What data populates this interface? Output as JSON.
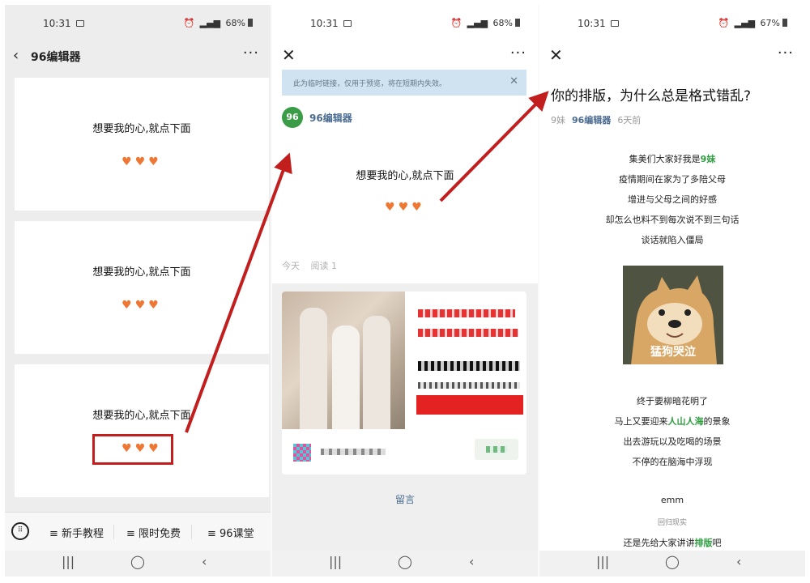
{
  "panel1": {
    "status": {
      "time": "10:31",
      "battery": "68%"
    },
    "title": "96编辑器",
    "cards": [
      {
        "text": "想要我的心,就点下面",
        "hearts": "♥♥♥"
      },
      {
        "text": "想要我的心,就点下面",
        "hearts": "♥♥♥"
      },
      {
        "text": "想要我的心,就点下面",
        "hearts": "♥♥♥"
      }
    ],
    "menu": [
      "≡ 新手教程",
      "≡ 限时免费",
      "≡ 96课堂"
    ]
  },
  "panel2": {
    "status": {
      "time": "10:31",
      "battery": "68%"
    },
    "notice": "此为临时链接，仅用于预览，将在短期内失效。",
    "account": "96编辑器",
    "text": "想要我的心,就点下面",
    "hearts": "♥♥♥",
    "meta": {
      "date": "今天",
      "reads": "阅读 1"
    },
    "comment": "留言"
  },
  "panel3": {
    "status": {
      "time": "10:31",
      "battery": "67%"
    },
    "title": "你的排版，为什么总是格式错乱?",
    "meta": {
      "author": "9妹",
      "account": "96编辑器",
      "date": "6天前"
    },
    "lines_top": [
      {
        "pre": "集美们大家好我是",
        "em": "9妹",
        "post": ""
      },
      {
        "pre": "疫情期间在家为了多陪父母",
        "em": "",
        "post": ""
      },
      {
        "pre": "增进与父母之间的好感",
        "em": "",
        "post": ""
      },
      {
        "pre": "却怎么也料不到每次说不到三句话",
        "em": "",
        "post": ""
      },
      {
        "pre": "谈话就陷入僵局",
        "em": "",
        "post": ""
      }
    ],
    "image_caption": "猛狗哭泣",
    "lines_bottom": [
      {
        "pre": "终于要柳暗花明了",
        "em": "",
        "post": ""
      },
      {
        "pre": "马上又要迎来",
        "em": "人山人海",
        "post": "的景象"
      },
      {
        "pre": "出去游玩以及吃喝的场景",
        "em": "",
        "post": ""
      },
      {
        "pre": "不停的在脑海中浮现",
        "em": "",
        "post": ""
      }
    ],
    "emm": "emm",
    "subnote": "回归现实",
    "last_line": {
      "pre": "还是先给大家讲讲",
      "em": "排版",
      "post": "吧"
    }
  },
  "colors": {
    "accent_red": "#c21e1e",
    "heart": "#ee7733",
    "green": "#2e9d3f",
    "link": "#4a6b90"
  }
}
